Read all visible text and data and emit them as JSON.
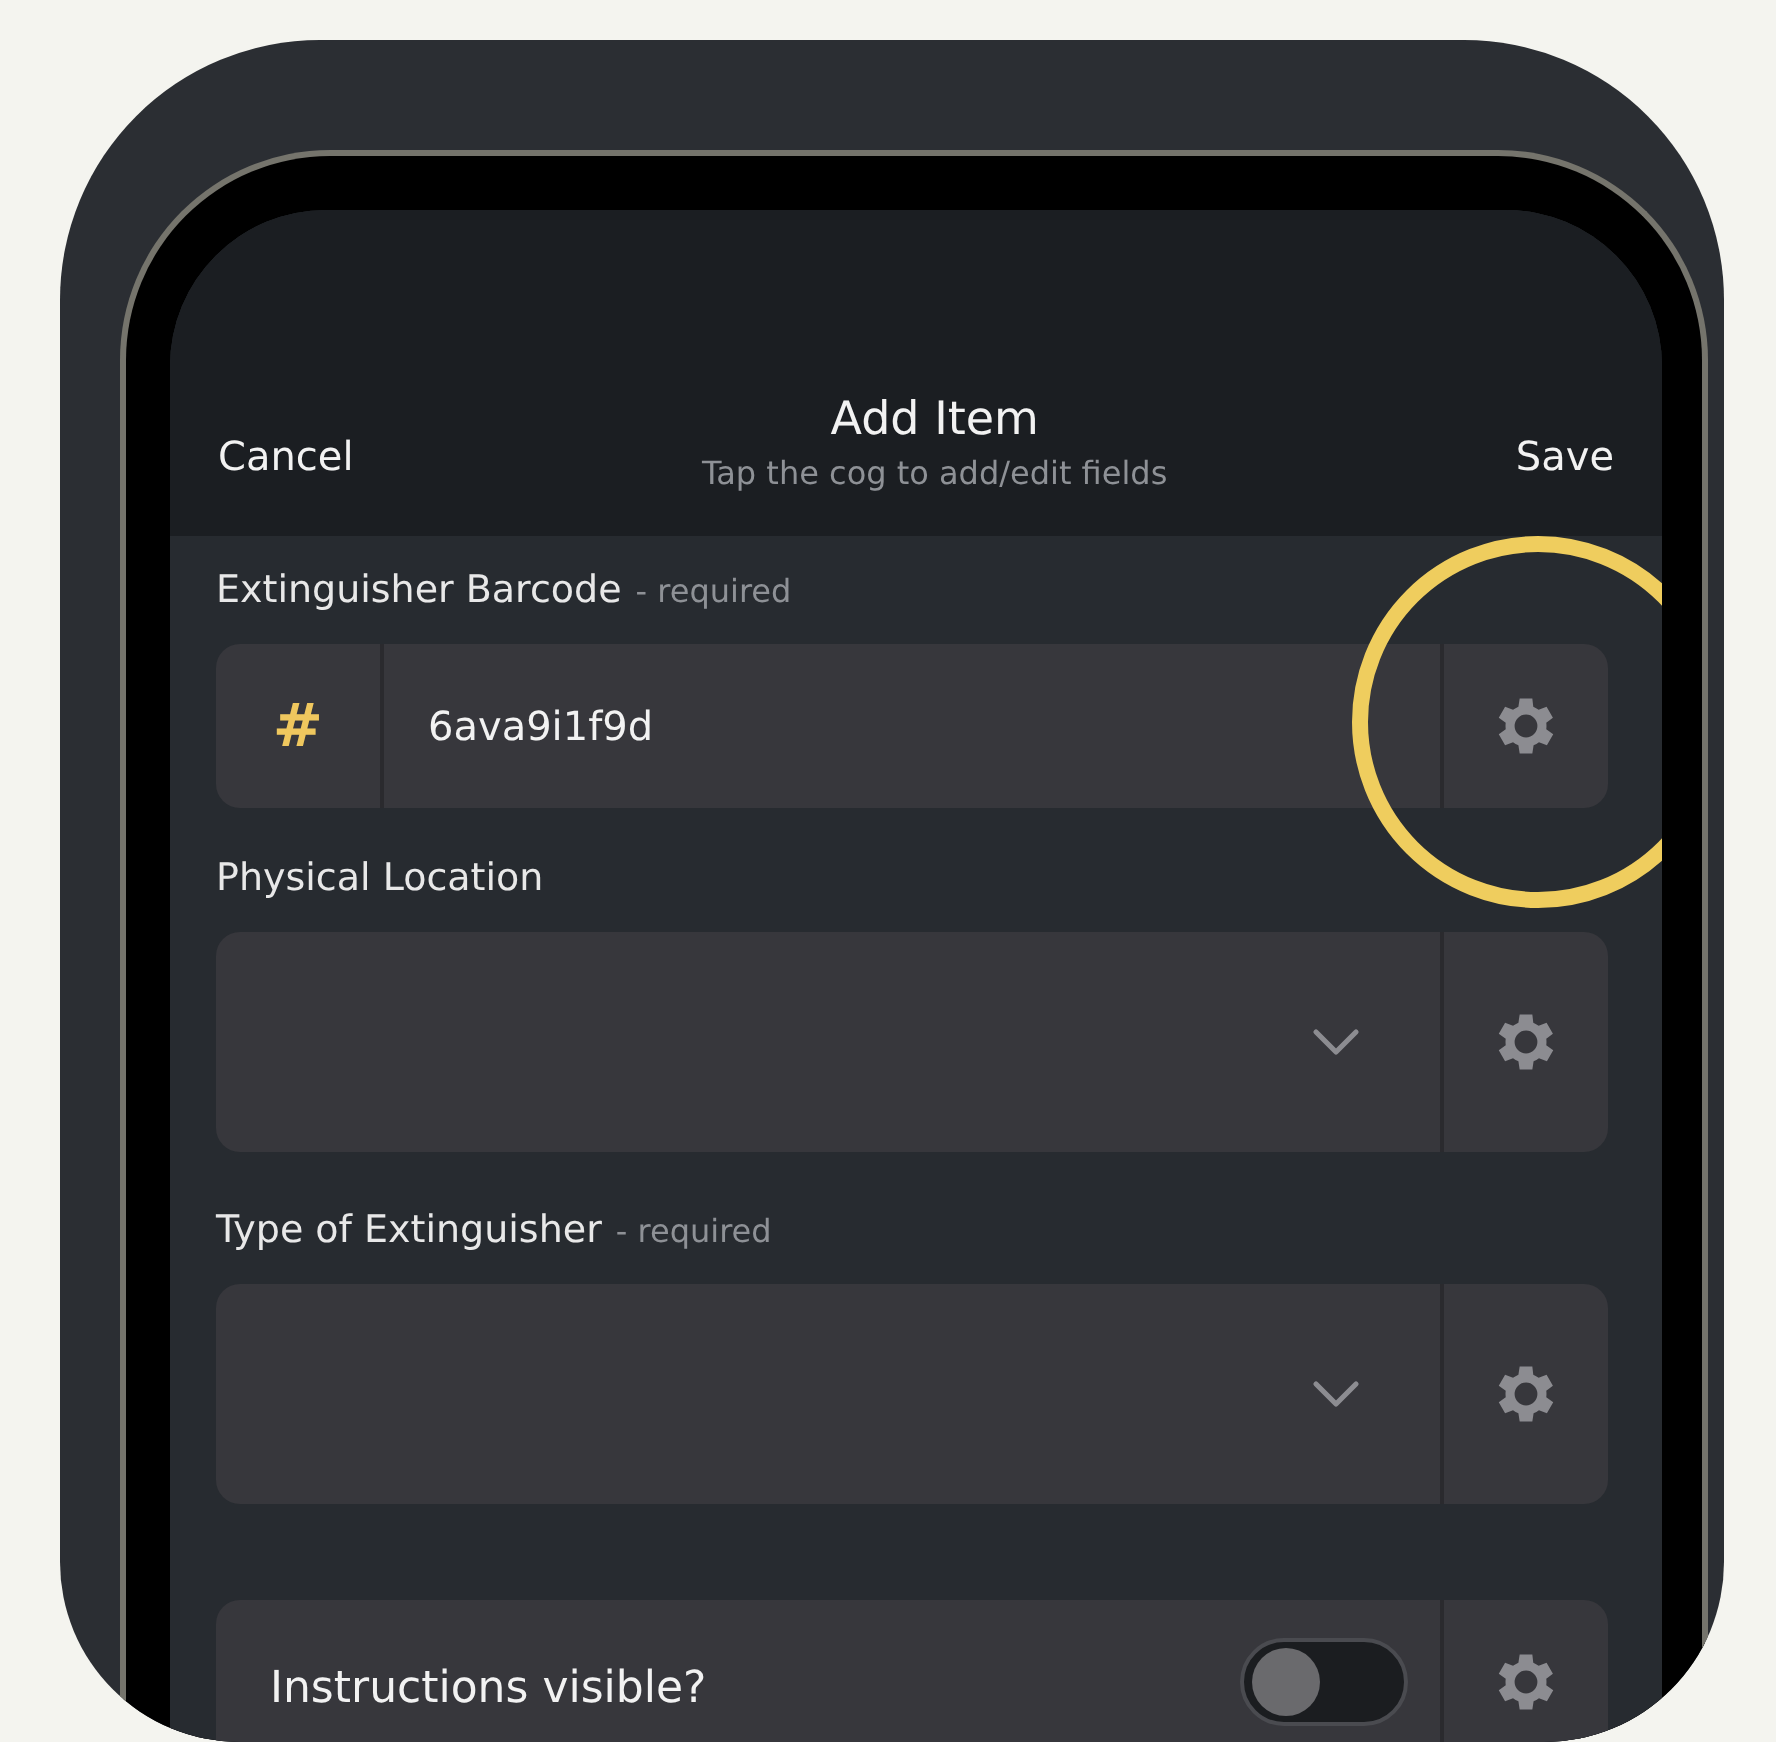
{
  "header": {
    "cancel": "Cancel",
    "title": "Add Item",
    "subtitle": "Tap the cog to add/edit fields",
    "save": "Save"
  },
  "fields": [
    {
      "kind": "text",
      "label": "Extinguisher Barcode",
      "note": "- required",
      "symbol": "#",
      "value": "6ava9i1f9d",
      "highlighted": true
    },
    {
      "kind": "select",
      "label": "Physical Location",
      "highlighted": false
    },
    {
      "kind": "select",
      "label": "Type of Extinguisher",
      "note": "- required",
      "highlighted": false
    },
    {
      "kind": "toggle",
      "label": "Instructions visible?",
      "on": false,
      "highlighted": false
    }
  ]
}
